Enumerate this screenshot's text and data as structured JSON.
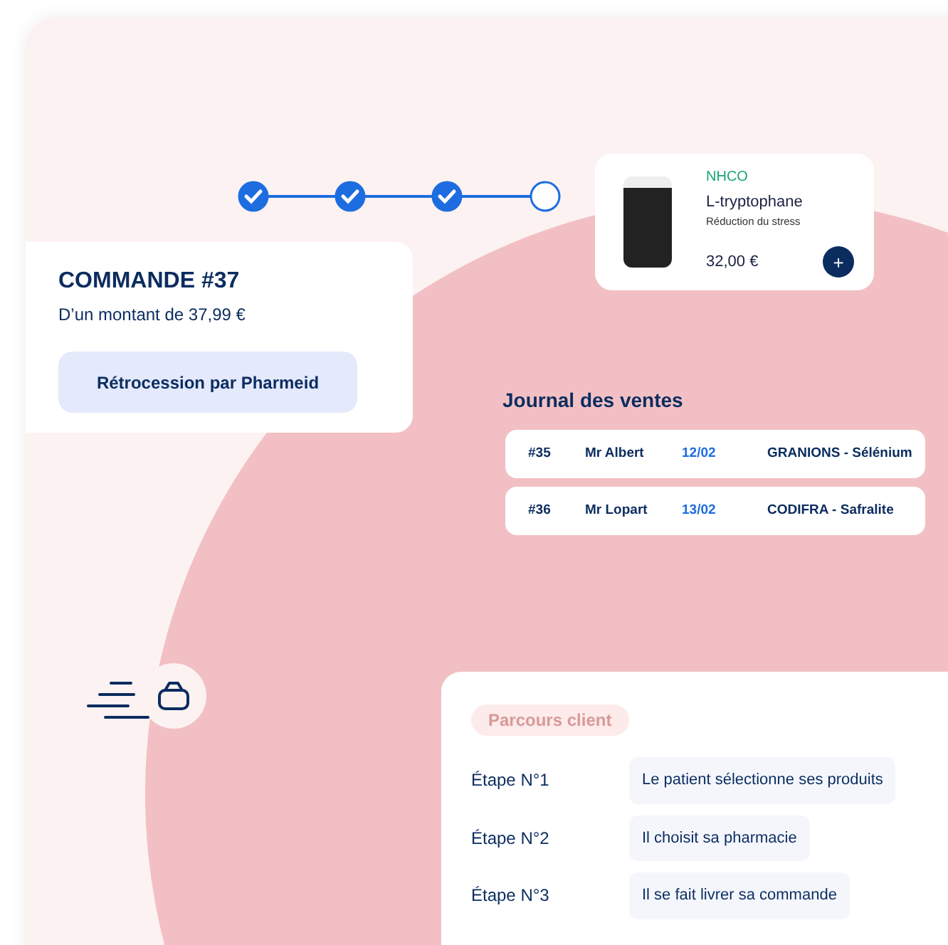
{
  "stepper": [
    {
      "done": true
    },
    {
      "done": true
    },
    {
      "done": true
    },
    {
      "done": false
    }
  ],
  "product": {
    "brand": "NHCO",
    "name": "L-tryptophane",
    "description": "Réduction du stress",
    "price": "32,00 €",
    "add_label": "+"
  },
  "order": {
    "title": "COMMANDE #37",
    "amount": "D’un montant de 37,99 €",
    "button": "Rétrocession par Pharmeid"
  },
  "sales_journal": {
    "title": "Journal des ventes",
    "rows": [
      {
        "number": "#35",
        "customer": "Mr Albert",
        "date": "12/02",
        "product": "GRANIONS - Sélénium"
      },
      {
        "number": "#36",
        "customer": "Mr Lopart",
        "date": "13/02",
        "product": "CODIFRA - Safralite"
      }
    ]
  },
  "customer_journey": {
    "badge": "Parcours client",
    "steps": [
      {
        "label": "Étape N°1",
        "text": "Le patient sélectionne ses produits"
      },
      {
        "label": "Étape N°2",
        "text": "Il choisit sa pharmacie"
      },
      {
        "label": "Étape N°3",
        "text": "Il se fait livrer sa commande"
      }
    ]
  }
}
